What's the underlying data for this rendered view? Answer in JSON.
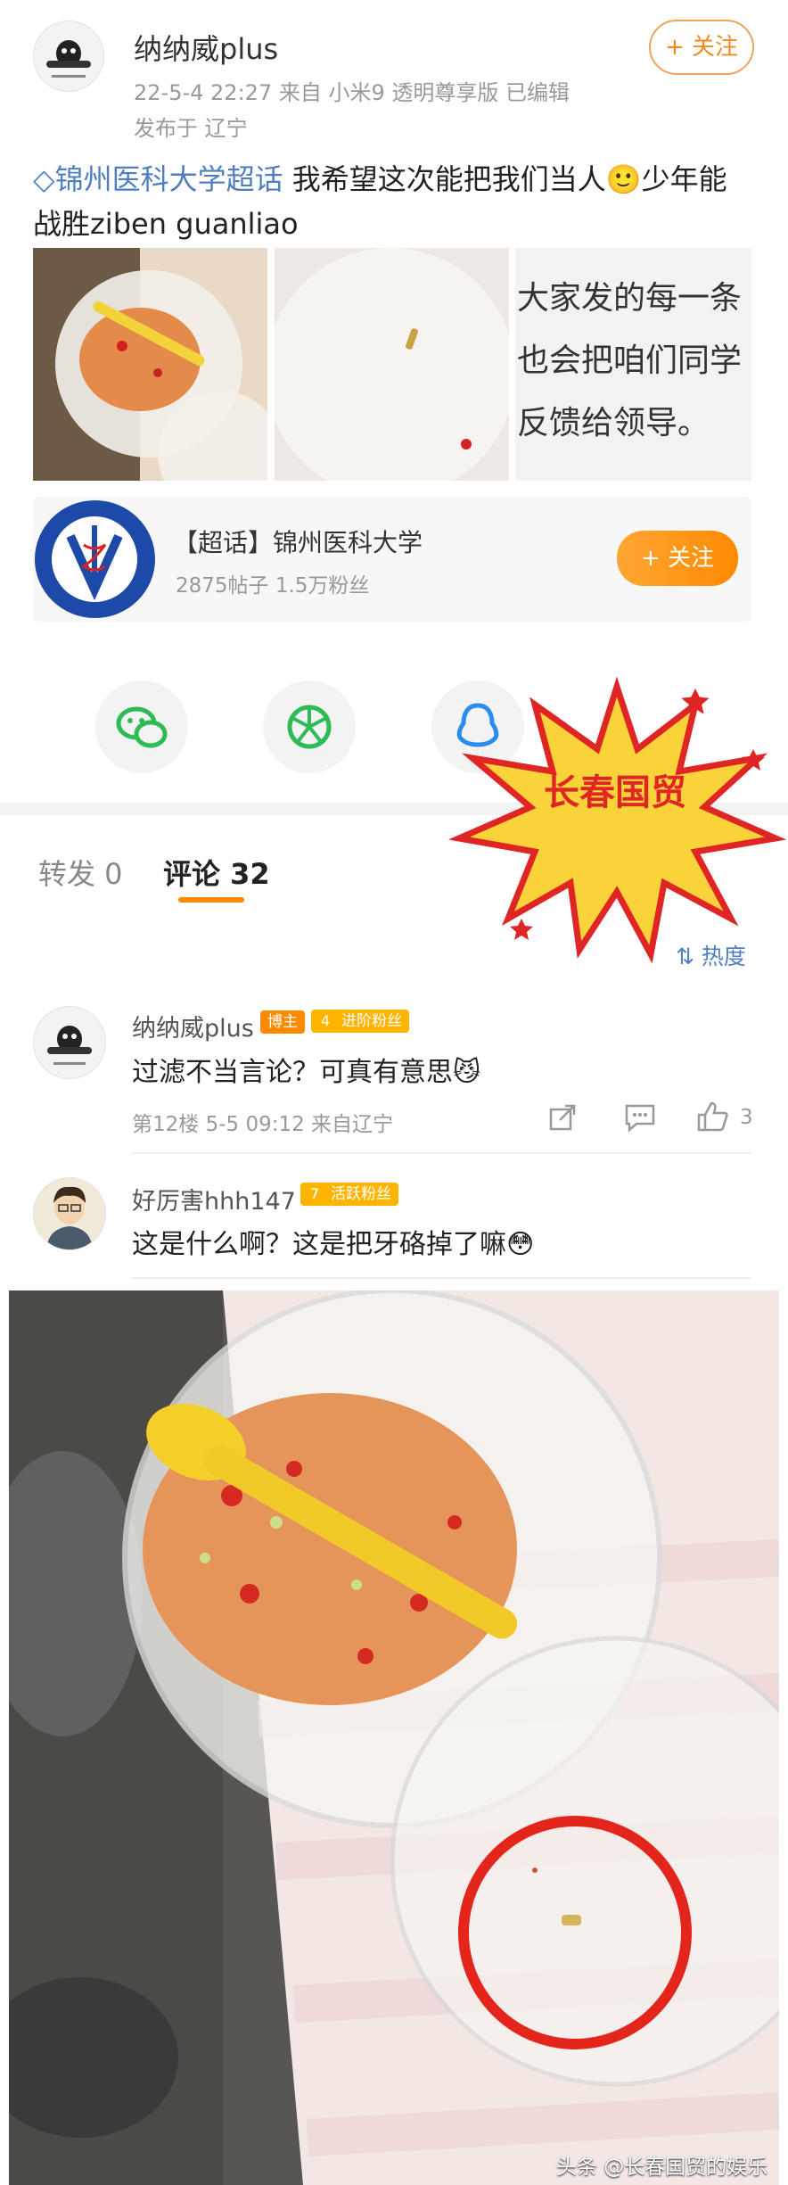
{
  "post": {
    "author": "纳纳威plus",
    "meta_line1": "22-5-4 22:27  来自 小米9 透明尊享版  已编辑",
    "meta_line2": "发布于 辽宁",
    "follow_label": "+ 关注",
    "topic": "锦州医科大学超话",
    "text_line1_rest": " 我希望这次能把我们当人🙂少年能",
    "text_line2": "战胜ziben guanliao",
    "image3_lines": [
      "大家发的每一条",
      "也会把咱们同学",
      "反馈给领导。"
    ]
  },
  "topic_card": {
    "title": "【超话】锦州医科大学",
    "stats": "2875帖子 1.5万粉丝",
    "follow_label": "+ 关注"
  },
  "share_icons": [
    "wechat-icon",
    "moments-icon",
    "qq-icon"
  ],
  "sticker": {
    "text": "长春国贸"
  },
  "tabs": {
    "repost": "转发 0",
    "comments": "评论 32",
    "sort": "热度"
  },
  "comments": [
    {
      "name": "纳纳威plus",
      "badge": "博主",
      "fan_level": "4",
      "fan_badge": "进阶粉丝",
      "text": "过滤不当言论？可真有意思😼",
      "meta": "第12楼  5-5 09:12  来自辽宁",
      "likes": "3"
    },
    {
      "name": "好厉害hhh147",
      "fan_level": "7",
      "fan_badge": "活跃粉丝",
      "text": "这是什么啊？这是把牙硌掉了嘛😳"
    }
  ],
  "watermark": "头条 @长春国贸的娱乐"
}
